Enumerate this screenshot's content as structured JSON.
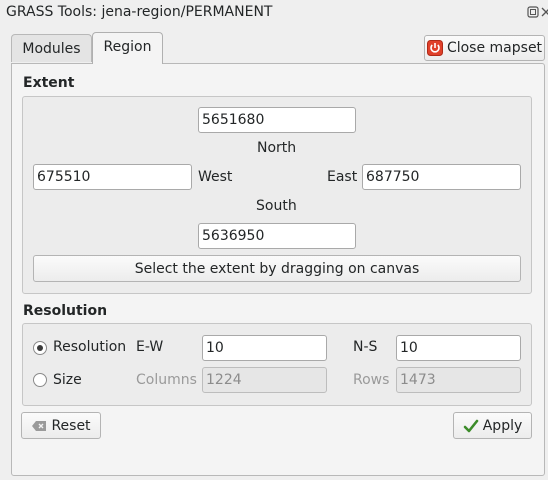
{
  "window": {
    "title": "GRASS Tools: jena-region/PERMANENT"
  },
  "tabs": [
    {
      "label": "Modules",
      "active": false
    },
    {
      "label": "Region",
      "active": true
    }
  ],
  "toolbar": {
    "close_mapset_label": "Close mapset"
  },
  "extent": {
    "title": "Extent",
    "north_value": "5651680",
    "north_label": "North",
    "west_value": "675510",
    "west_label": "West",
    "east_label": "East",
    "east_value": "687750",
    "south_label": "South",
    "south_value": "5636950",
    "select_button_label": "Select the extent by dragging on canvas"
  },
  "resolution": {
    "title": "Resolution",
    "resolution_radio_label": "Resolution",
    "resolution_selected": true,
    "ew_label": "E-W",
    "ew_value": "10",
    "ns_label": "N-S",
    "ns_value": "10",
    "size_radio_label": "Size",
    "columns_label": "Columns",
    "columns_value": "1224",
    "rows_label": "Rows",
    "rows_value": "1473"
  },
  "actions": {
    "reset_label": "Reset",
    "apply_label": "Apply"
  },
  "colors": {
    "close_icon_bg": "#e0402a",
    "apply_check": "#3c8c2a"
  }
}
